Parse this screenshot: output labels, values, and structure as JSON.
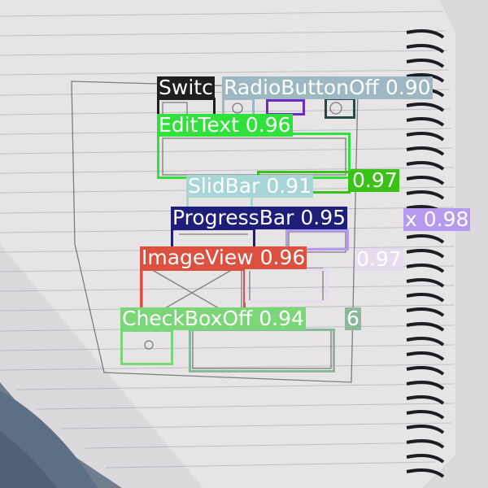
{
  "detections": [
    {
      "id": "switch",
      "label_text": "Switc",
      "color": "#1f1f1f",
      "text_color": "#ffffff"
    },
    {
      "id": "radiobuttonoff",
      "label_text": "RadioButtonOff 0.90",
      "color": "#9db7c3",
      "text_color": "#ffffff"
    },
    {
      "id": "radio-inner",
      "label_text": "",
      "color": "#6a2cc2",
      "text_color": "#ffffff"
    },
    {
      "id": "radio-dark",
      "label_text": "",
      "color": "#254a47",
      "text_color": "#ffffff"
    },
    {
      "id": "edittext",
      "label_text": "EditText 0.96",
      "color": "#2fe13a",
      "text_color": "#ffffff"
    },
    {
      "id": "button",
      "label_text": "0.97",
      "color": "#3ac218",
      "text_color": "#ffffff"
    },
    {
      "id": "slidbar",
      "label_text": "SlidBar 0.91",
      "color": "#a7d6d6",
      "text_color": "#ffffff"
    },
    {
      "id": "progressbar",
      "label_text": "ProgressBar 0.95",
      "color": "#1e1e7a",
      "text_color": "#ffffff"
    },
    {
      "id": "checkbox-on",
      "label_text": "x 0.98",
      "color": "#b69af0",
      "text_color": "#ffffff"
    },
    {
      "id": "imageview",
      "label_text": "ImageView 0.96",
      "color": "#dd5040",
      "text_color": "#ffffff"
    },
    {
      "id": "imageview2",
      "label_text": "0.97",
      "color": "#e6dced",
      "text_color": "#ffffff"
    },
    {
      "id": "checkboxoff",
      "label_text": "CheckBoxOff 0.94",
      "color": "#7bd678",
      "text_color": "#ffffff"
    },
    {
      "id": "textview",
      "label_text": "6",
      "color": "#8ab89a",
      "text_color": "#ffffff"
    }
  ]
}
